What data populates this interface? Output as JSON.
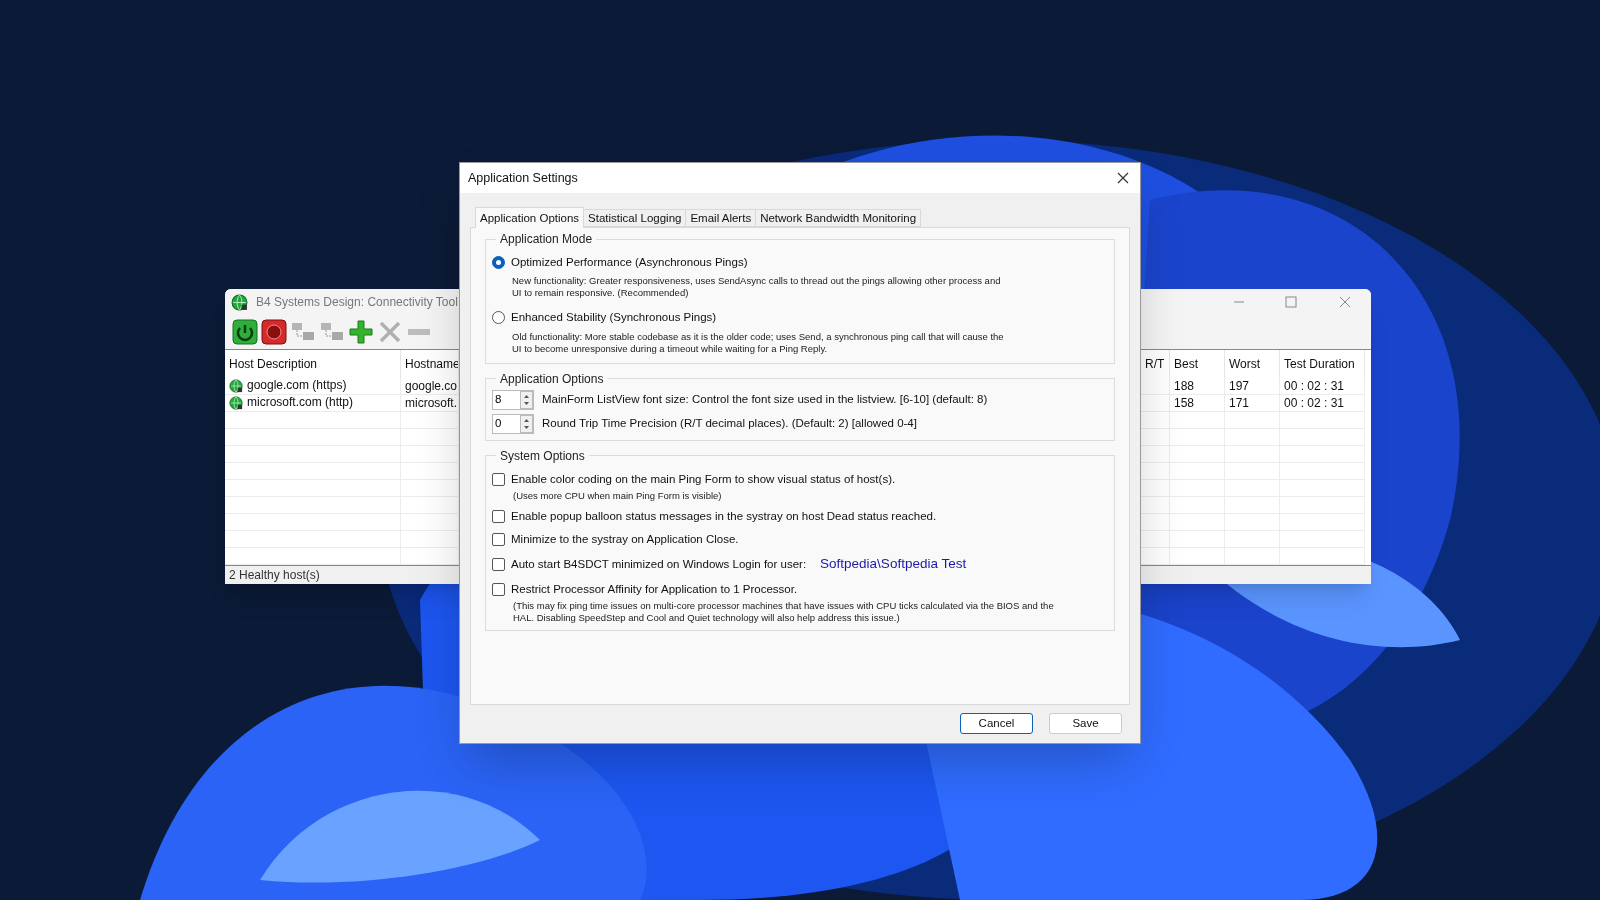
{
  "background_window": {
    "title": "B4 Systems Design:  Connectivity Tool",
    "columns": [
      {
        "label": "Host Description"
      },
      {
        "label": "Hostname"
      },
      {
        "label": "R/T"
      },
      {
        "label": "Best"
      },
      {
        "label": "Worst"
      },
      {
        "label": "Test Duration"
      }
    ],
    "rows": [
      {
        "host_description": "google.com (https)",
        "hostname": "google.co",
        "best": "188",
        "worst": "197",
        "test_duration": "00 : 02 : 31"
      },
      {
        "host_description": "microsoft.com (http)",
        "hostname": "microsoft.",
        "best": "158",
        "worst": "171",
        "test_duration": "00 : 02 : 31"
      }
    ],
    "status_bar": "2 Healthy host(s)"
  },
  "dialog": {
    "title": "Application Settings",
    "tabs": [
      {
        "label": "Application Options",
        "selected": true
      },
      {
        "label": "Statistical Logging",
        "selected": false
      },
      {
        "label": "Email Alerts",
        "selected": false
      },
      {
        "label": "Network Bandwidth Monitoring",
        "selected": false
      }
    ],
    "application_mode": {
      "title": "Application Mode",
      "options": [
        {
          "label": "Optimized Performance (Asynchronous Pings)",
          "description": "New functionality: Greater responsiveness, uses SendAsync calls to thread out the pings allowing other process and UI to remain responsive. (Recommended)",
          "selected": true
        },
        {
          "label": "Enhanced Stability (Synchronous Pings)",
          "description": "Old functionality: More stable codebase as it is the older code; uses Send, a synchronous ping call that will cause the UI to become unresponsive during a timeout while waiting for a Ping Reply.",
          "selected": false
        }
      ]
    },
    "application_options": {
      "title": "Application Options",
      "spinners": [
        {
          "value": "8",
          "label": "MainForm ListView font size: Control the font size used in the listview. [6-10] (default: 8)"
        },
        {
          "value": "0",
          "label": "Round Trip Time Precision (R/T decimal places). (Default: 2) [allowed 0-4]"
        }
      ]
    },
    "system_options": {
      "title": "System Options",
      "items": [
        {
          "label": "Enable color coding on the main Ping Form to show visual status of host(s).",
          "note": "(Uses more CPU when main Ping Form is visible)",
          "checked": false
        },
        {
          "label": "Enable popup balloon status messages in the systray on host Dead status reached.",
          "checked": false
        },
        {
          "label": "Minimize to the systray on Application Close.",
          "checked": false
        },
        {
          "label": "Auto start B4SDCT minimized on Windows Login for user:",
          "user": "Softpedia\\Softpedia Test",
          "checked": false
        },
        {
          "label": "Restrict Processor Affinity for Application to 1 Processor.",
          "note": "(This may fix ping time issues on multi-core processor machines that have issues with CPU ticks calculated via the BIOS and the HAL. Disabling SpeedStep and Cool and Quiet technology will also help address this issue.)",
          "checked": false
        }
      ]
    },
    "buttons": [
      {
        "label": "Cancel",
        "focused": true
      },
      {
        "label": "Save",
        "focused": false
      }
    ]
  }
}
